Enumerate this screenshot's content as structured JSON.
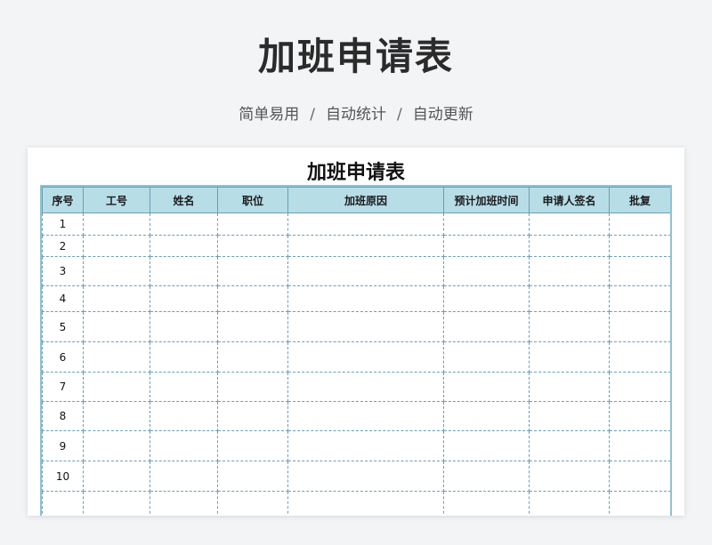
{
  "header": {
    "title": "加班申请表",
    "features": [
      "简单易用",
      "自动统计",
      "自动更新"
    ],
    "separator": "/"
  },
  "sheet": {
    "title": "加班申请表",
    "columns": [
      "序号",
      "工号",
      "姓名",
      "职位",
      "加班原因",
      "预计加班时间",
      "申请人签名",
      "批复"
    ],
    "rows": [
      "1",
      "2",
      "3",
      "4",
      "5",
      "6",
      "7",
      "8",
      "9",
      "10",
      ""
    ]
  }
}
